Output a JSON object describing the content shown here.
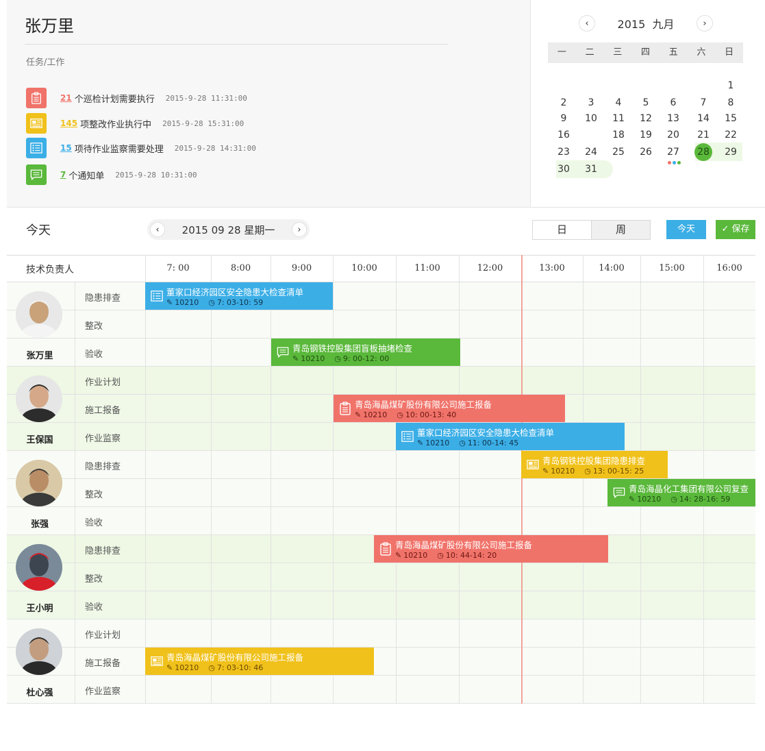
{
  "header": {
    "user_name": "张万里",
    "section_label": "任务/工作"
  },
  "tasks": [
    {
      "count": "21",
      "text": "个巡检计划需要执行",
      "time": "2015-9-28 11:31:00",
      "color": "#f0736a",
      "icon": "clipboard-icon"
    },
    {
      "count": "145",
      "text": "项整改作业执行中",
      "time": "2015-9-28  15:31:00",
      "color": "#f0c11b",
      "icon": "document-icon"
    },
    {
      "count": "15",
      "text": "项待作业监察需要处理",
      "time": "2015-9-28 14:31:00",
      "color": "#3baee6",
      "icon": "list-icon"
    },
    {
      "count": "7",
      "text": "个通知单",
      "time": "2015-9-28  10:31:00",
      "color": "#5ab83b",
      "icon": "message-icon"
    }
  ],
  "calendar": {
    "year": "2015",
    "month": "九月",
    "prev": "‹",
    "next": "›",
    "weekdays": [
      "一",
      "二",
      "三",
      "四",
      "五",
      "六",
      "日"
    ],
    "weeks": [
      [
        "",
        "",
        "",
        "",
        "",
        "",
        "1"
      ],
      [
        "2",
        "3",
        "4",
        "5",
        "6",
        "7",
        "8"
      ],
      [
        "9",
        "10",
        "11",
        "12",
        "13",
        "14",
        "15"
      ],
      [
        "16",
        "",
        "18",
        "19",
        "20",
        "21",
        "22"
      ],
      [
        "23",
        "24",
        "25",
        "26",
        "27",
        "28",
        "29"
      ],
      [
        "30",
        "31",
        "",
        "",
        "",
        "",
        ""
      ]
    ],
    "selected_day": "28",
    "dot_colors": [
      "#f0736a",
      "#3baee6",
      "#5ab83b"
    ]
  },
  "toolbar": {
    "today_label": "今天",
    "date_text": "2015 09 28 星期一",
    "prev": "‹",
    "next": "›",
    "view_day": "日",
    "view_week": "周",
    "today_button": "今天",
    "save_button": "保存",
    "save_check": "✓"
  },
  "schedule": {
    "head_label": "技术负责人",
    "hours": [
      "7: 00",
      "8:00",
      "9:00",
      "10:00",
      "11:00",
      "12:00",
      "13:00",
      "14:00",
      "15:00",
      "16:00"
    ],
    "people": [
      {
        "name": "张万里",
        "rows": [
          "隐患排查",
          "整改",
          "验收"
        ]
      },
      {
        "name": "王保国",
        "rows": [
          "作业计划",
          "施工报备",
          "作业监察"
        ]
      },
      {
        "name": "张强",
        "rows": [
          "隐患排查",
          "整改",
          "验收"
        ]
      },
      {
        "name": "王小明",
        "rows": [
          "隐患排查",
          "整改",
          "验收"
        ]
      },
      {
        "name": "杜心强",
        "rows": [
          "作业计划",
          "施工报备",
          "作业监察"
        ]
      }
    ],
    "events": [
      {
        "title": "董家口经济园区安全隐患大检查清单",
        "code": "10210",
        "time": "7: 03-10: 59",
        "color": "#3baee6",
        "icon": "list-icon"
      },
      {
        "title": "青岛钢铁控股集团盲板抽堵检查",
        "code": "10210",
        "time": "9: 00-12: 00",
        "color": "#5ab83b",
        "icon": "message-icon"
      },
      {
        "title": "青岛海晶煤矿股份有限公司施工报备",
        "code": "10210",
        "time": "10: 00-13: 40",
        "color": "#f0736a",
        "icon": "clipboard-icon"
      },
      {
        "title": "董家口经济园区安全隐患大检查清单",
        "code": "10210",
        "time": "11: 00-14: 45",
        "color": "#3baee6",
        "icon": "list-icon"
      },
      {
        "title": "青岛钢铁控股集团隐患排查",
        "code": "10210",
        "time": "13: 00-15: 25",
        "color": "#f0c11b",
        "icon": "document-icon"
      },
      {
        "title": "青岛海晶化工集团有限公司复查",
        "code": "10210",
        "time": "14: 28-16: 59",
        "color": "#5ab83b",
        "icon": "message-icon"
      },
      {
        "title": "青岛海晶煤矿股份有限公司施工报备",
        "code": "10210",
        "time": "10: 44-14: 20",
        "color": "#f0736a",
        "icon": "clipboard-icon"
      },
      {
        "title": "青岛海晶煤矿股份有限公司施工报备",
        "code": "10210",
        "time": "7: 03-10: 46",
        "color": "#f0c11b",
        "icon": "document-icon"
      }
    ]
  }
}
